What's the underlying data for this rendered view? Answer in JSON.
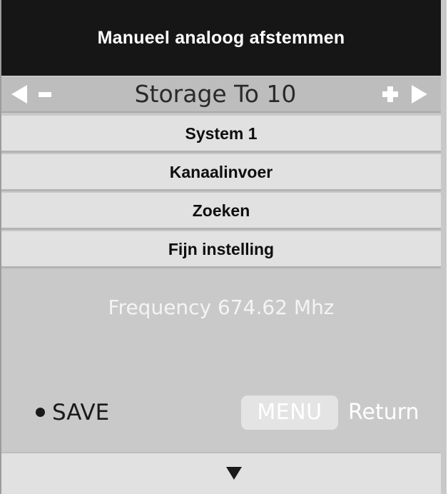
{
  "header": {
    "title": "Manueel analoog afstemmen"
  },
  "storage": {
    "label": "Storage To 10",
    "left_icons": [
      "left-arrow-icon",
      "minus-icon"
    ],
    "right_icons": [
      "plus-icon",
      "right-arrow-icon"
    ]
  },
  "menu": {
    "items": [
      {
        "label": "System 1"
      },
      {
        "label": "Kanaalinvoer"
      },
      {
        "label": "Zoeken"
      },
      {
        "label": "Fijn instelling"
      }
    ]
  },
  "info": {
    "frequency": "Frequency 674.62 Mhz",
    "save_label": "SAVE",
    "menu_key_label": "MENU",
    "return_label": "Return"
  },
  "footer": {
    "icon": "down-arrow-icon"
  },
  "colors": {
    "header_bg": "#161616",
    "row_bg": "#e1e1e1",
    "panel_bg": "#c9c9c9"
  }
}
